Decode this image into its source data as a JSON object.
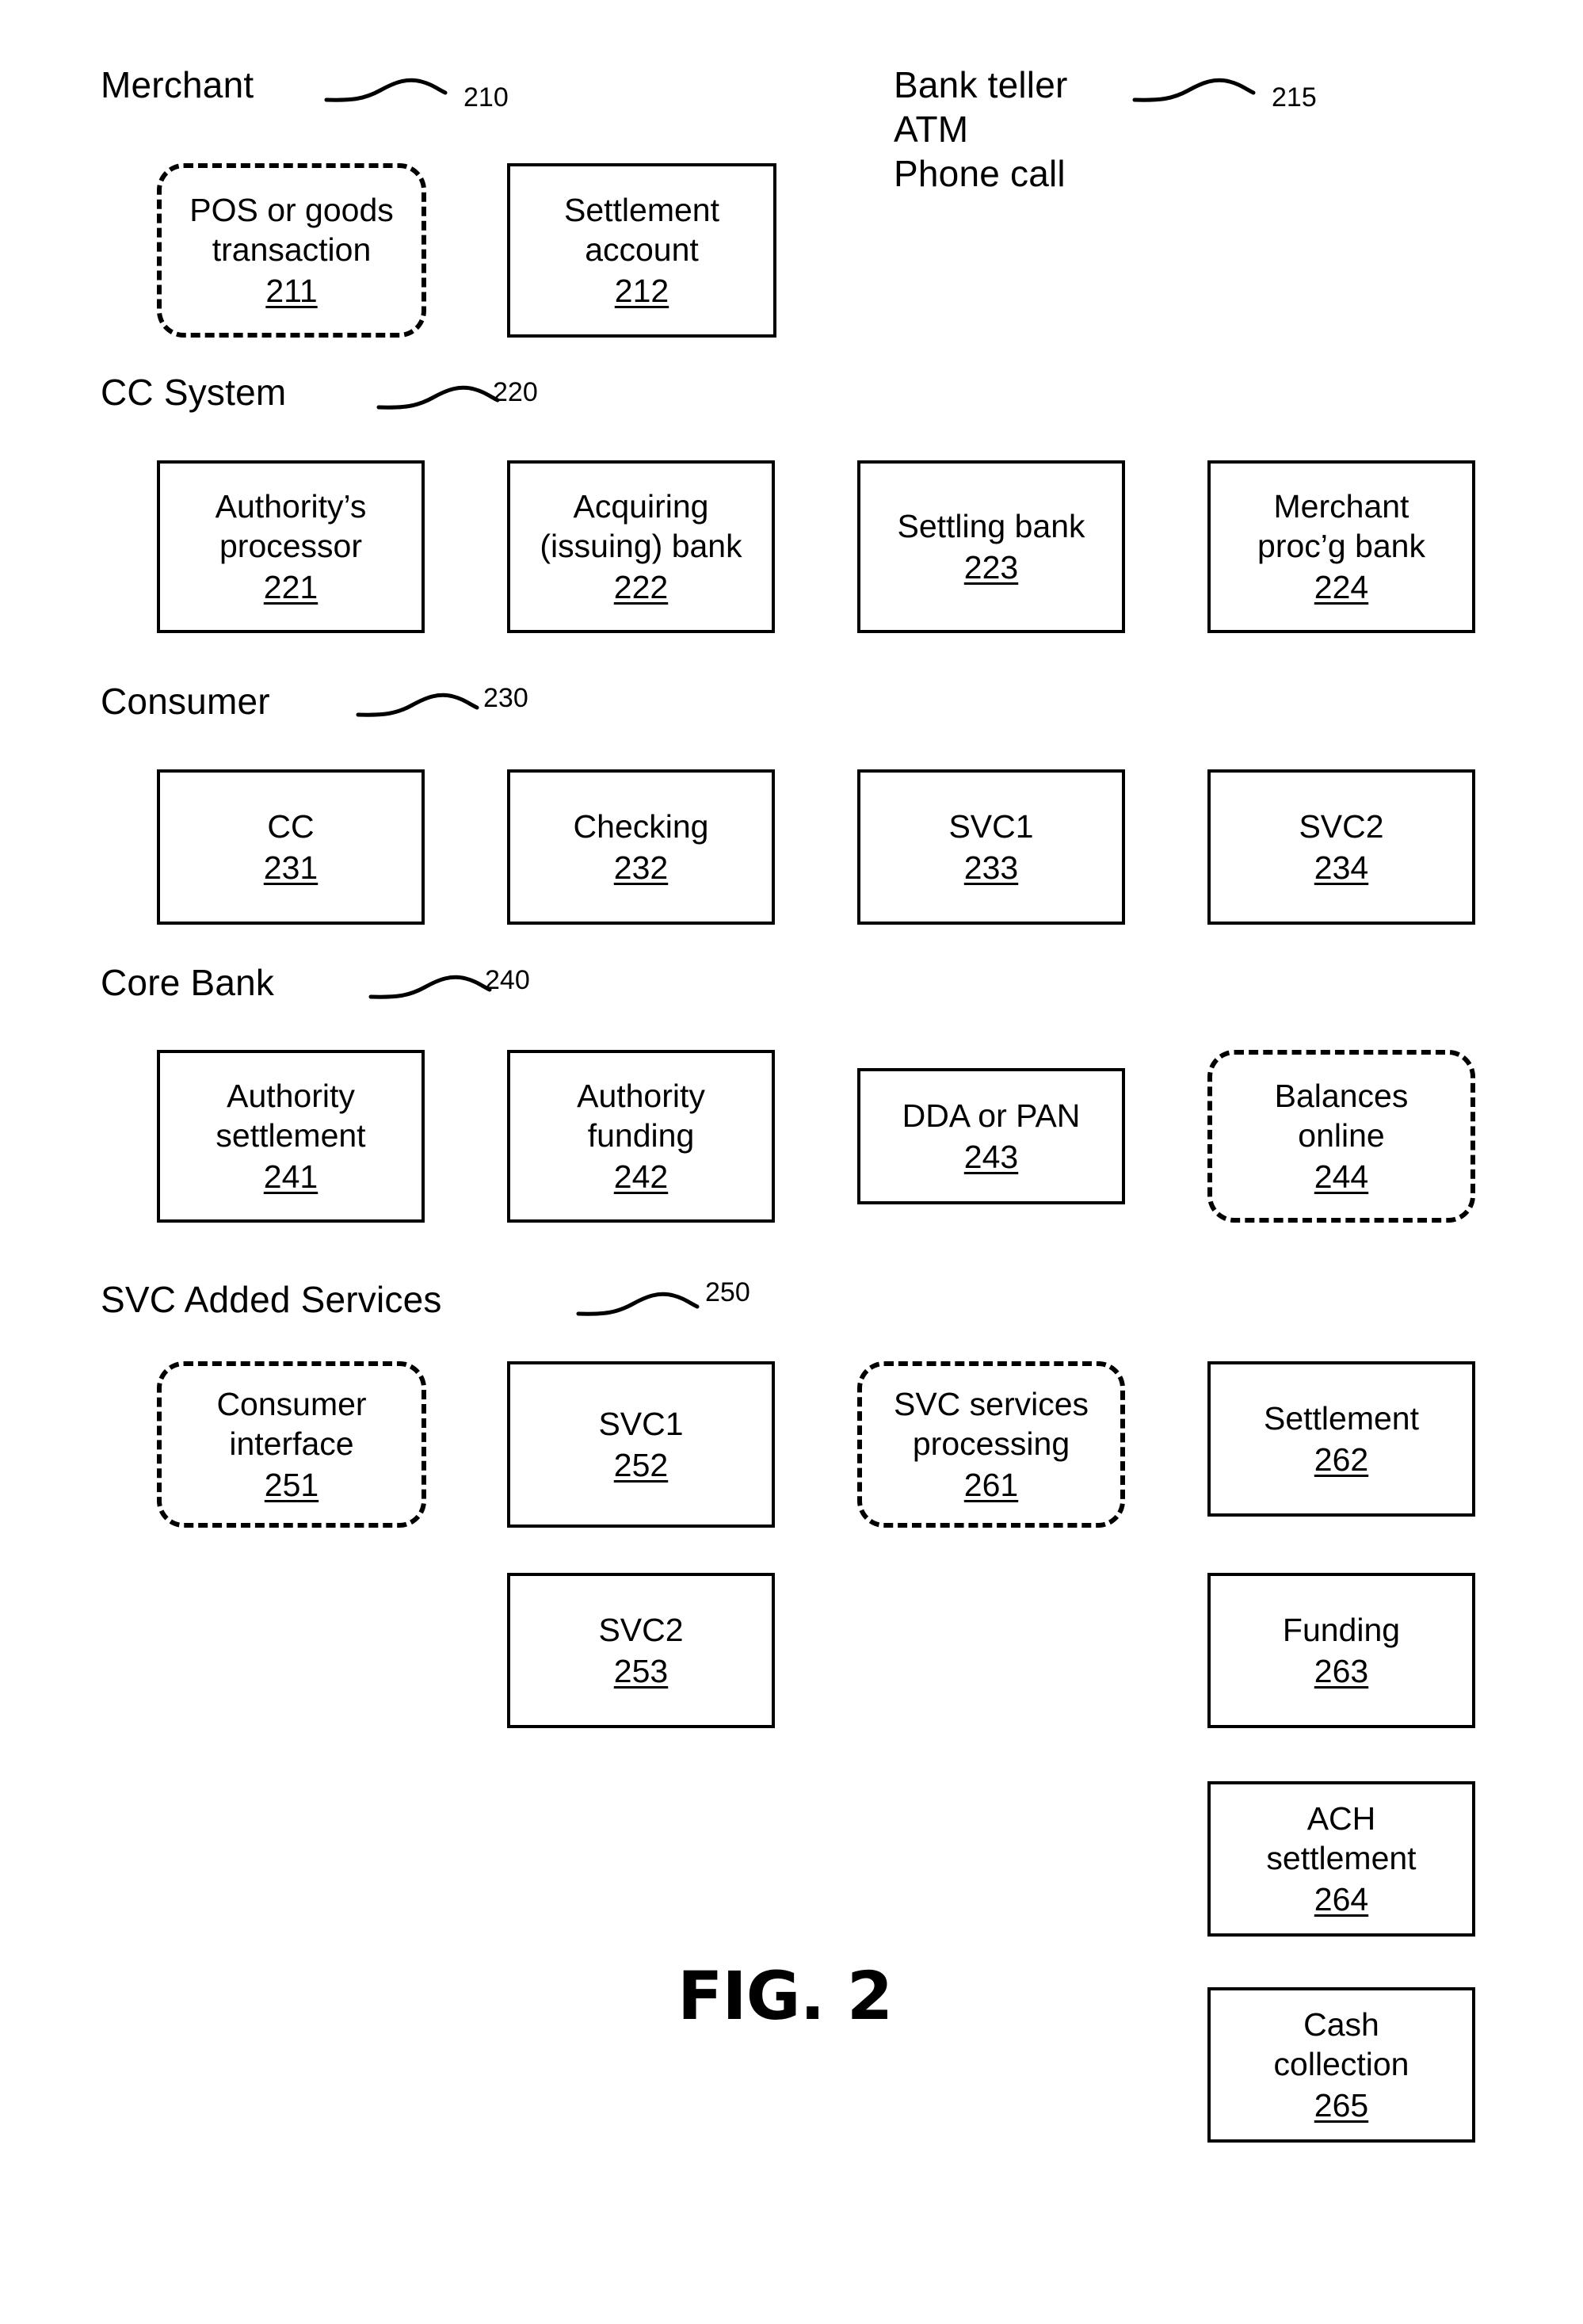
{
  "figure": {
    "caption": "FIG. 2",
    "tiers": [
      {
        "id": "merchant",
        "label": "Merchant",
        "ref": "210"
      },
      {
        "id": "bank-teller",
        "label": "Bank teller",
        "label_line2": "ATM",
        "label_line3": "Phone call",
        "ref": "215"
      },
      {
        "id": "cc-system",
        "label": "CC System",
        "ref": "220"
      },
      {
        "id": "consumer",
        "label": "Consumer",
        "ref": "230"
      },
      {
        "id": "core-bank",
        "label": "Core Bank",
        "ref": "240"
      },
      {
        "id": "svc-added-services",
        "label": "SVC Added Services",
        "ref": "250"
      }
    ],
    "boxes": [
      {
        "id": "b211",
        "text": "POS or goods\ntransaction",
        "num": "211",
        "style": "dashed"
      },
      {
        "id": "b212",
        "text": "Settlement\naccount",
        "num": "212",
        "style": "solid"
      },
      {
        "id": "b221",
        "text": "Authority’s\nprocessor",
        "num": "221",
        "style": "solid"
      },
      {
        "id": "b222",
        "text": "Acquiring\n(issuing) bank",
        "num": "222",
        "style": "solid"
      },
      {
        "id": "b223",
        "text": "Settling bank",
        "num": "223",
        "style": "solid"
      },
      {
        "id": "b224",
        "text": "Merchant\nproc’g bank",
        "num": "224",
        "style": "solid"
      },
      {
        "id": "b231",
        "text": "CC",
        "num": "231",
        "style": "solid"
      },
      {
        "id": "b232",
        "text": "Checking",
        "num": "232",
        "style": "solid"
      },
      {
        "id": "b233",
        "text": "SVC1",
        "num": "233",
        "style": "solid"
      },
      {
        "id": "b234",
        "text": "SVC2",
        "num": "234",
        "style": "solid"
      },
      {
        "id": "b241",
        "text": "Authority\nsettlement",
        "num": "241",
        "style": "solid"
      },
      {
        "id": "b242",
        "text": "Authority\nfunding",
        "num": "242",
        "style": "solid"
      },
      {
        "id": "b243",
        "text": "DDA or PAN",
        "num": "243",
        "style": "solid"
      },
      {
        "id": "b244",
        "text": "Balances\nonline",
        "num": "244",
        "style": "dashed"
      },
      {
        "id": "b251",
        "text": "Consumer\ninterface",
        "num": "251",
        "style": "dashed"
      },
      {
        "id": "b252",
        "text": "SVC1",
        "num": "252",
        "style": "solid"
      },
      {
        "id": "b261",
        "text": "SVC services\nprocessing",
        "num": "261",
        "style": "dashed"
      },
      {
        "id": "b262",
        "text": "Settlement",
        "num": "262",
        "style": "solid"
      },
      {
        "id": "b253",
        "text": "SVC2",
        "num": "253",
        "style": "solid"
      },
      {
        "id": "b263",
        "text": "Funding",
        "num": "263",
        "style": "solid"
      },
      {
        "id": "b264",
        "text": "ACH\nsettlement",
        "num": "264",
        "style": "solid"
      },
      {
        "id": "b265",
        "text": "Cash\ncollection",
        "num": "265",
        "style": "solid"
      }
    ]
  }
}
